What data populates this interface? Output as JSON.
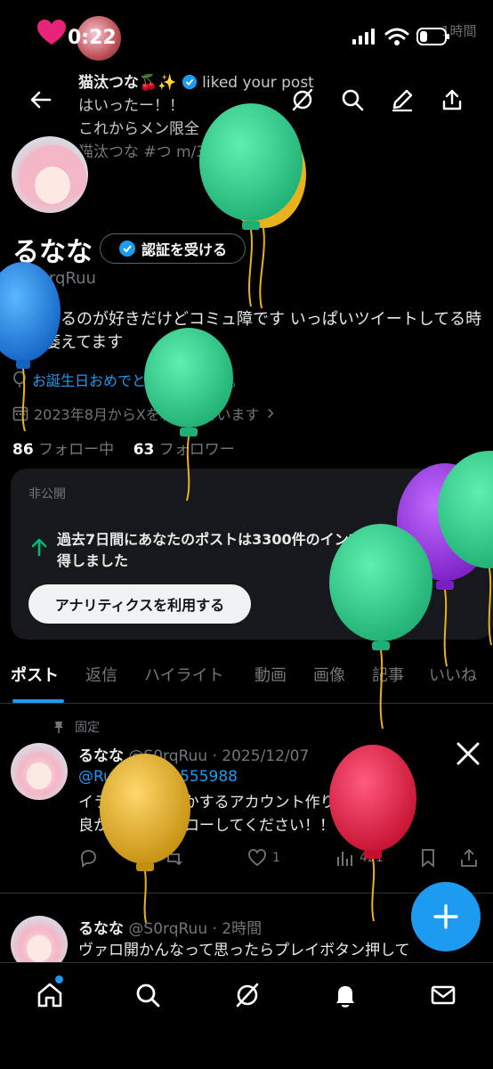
{
  "status_bar": {
    "time": "0:22",
    "ghost_text": "1時間"
  },
  "notification": {
    "name": "猫汰つな🍒✨",
    "action": "liked your post",
    "line1": "はいったー！！",
    "line2": "これからメン限全",
    "line3": "猫汰つな #つ                 m/3eTinCWYP4"
  },
  "profile": {
    "display_name": "るなな",
    "verify_button": "認証を受ける",
    "handle": "@S0rqRuu",
    "bio": "お話するのが好きだけどコミュ障です いっぱいツイートしてる時大体萎えてます",
    "birthday": "お誕生日おめでとうございます。",
    "joined": "2023年8月からXを利用しています",
    "following_count": "86",
    "following_label": "フォロー中",
    "followers_count": "63",
    "followers_label": "フォロワー"
  },
  "private_card": {
    "label": "非公開",
    "impression_text": "過去7日間にあなたのポストは3300件のインプレッションを獲得しました",
    "analytics_button": "アナリティクスを利用する"
  },
  "tabs": [
    "ポスト",
    "返信",
    "ハイライト",
    "動画",
    "画像",
    "記事",
    "いいね"
  ],
  "pinned_post": {
    "pinned_label": "固定",
    "author": "るなな",
    "meta": "@S0rqRuu · 2025/12/07",
    "mention": "@Runa19818555988",
    "body_line1": "イラスト依頼とかするアカウント作りました！",
    "body_line2": "良かったらフォローしてください！！",
    "likes": "1",
    "views": "421"
  },
  "post2": {
    "author": "るなな",
    "meta": "@S0rqRuu · 2時間",
    "body": "ヴァロ開かんなって思ったらプレイボタン押して"
  },
  "colors": {
    "accent": "#1d9bf0",
    "balloon_green": "#2ecf8c",
    "balloon_blue": "#1f8fe6",
    "balloon_purple": "#8f2fd6",
    "balloon_gold": "#e8b21e",
    "balloon_red": "#e21b4a"
  }
}
